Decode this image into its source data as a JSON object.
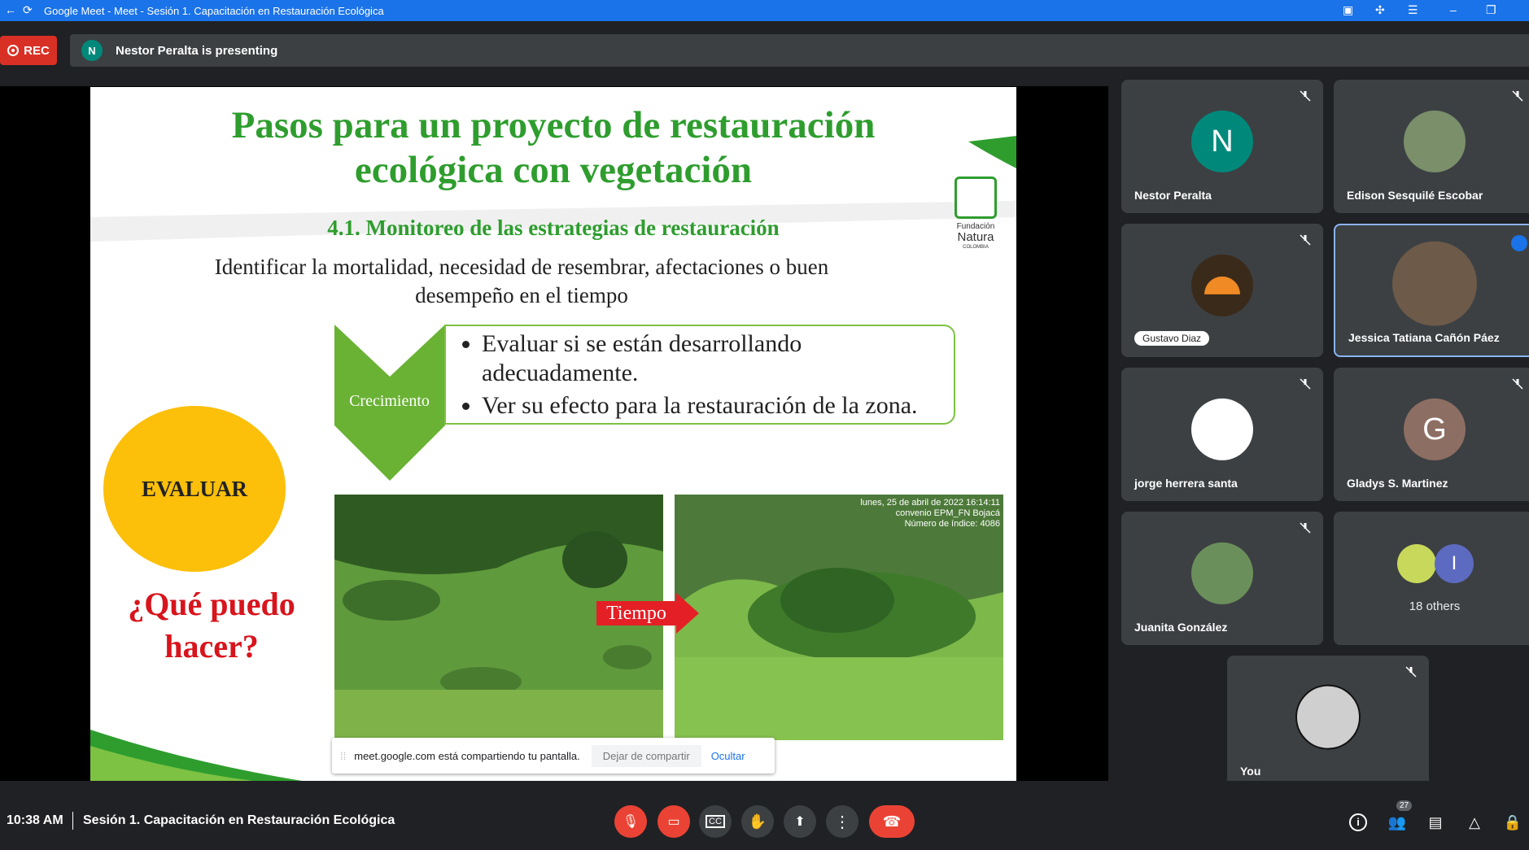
{
  "window": {
    "title": "Google Meet - Meet - Sesión 1. Capacitación en Restauración Ecológica"
  },
  "rec_label": "REC",
  "presenter": {
    "initial": "N",
    "text": "Nestor Peralta is presenting"
  },
  "slide": {
    "title_line1": "Pasos para un proyecto de restauración",
    "title_line2": "ecológica con vegetación",
    "subtitle": "4.1. Monitoreo de las estrategias de restauración",
    "description": "Identificar la mortalidad, necesidad de resembrar, afectaciones o buen desempeño en el tiempo",
    "chevron_label": "Crecimiento",
    "bullet1": "Evaluar si se están desarrollando adecuadamente.",
    "bullet2": "Ver su efecto para la restauración de la zona.",
    "evaluar": "EVALUAR",
    "question_line1": "¿Qué puedo",
    "question_line2": "hacer?",
    "tiempo": "Tiempo",
    "stamp_line1": "lunes, 25 de abril de 2022 16:14:11",
    "stamp_line2": "convenio EPM_FN Bojacá",
    "stamp_line3": "Número de índice: 4086",
    "logo_line1": "Fundación",
    "logo_line2": "Natura",
    "logo_line3": "COLOMBIA"
  },
  "share_bar": {
    "message": "meet.google.com está compartiendo tu pantalla.",
    "stop_label": "Dejar de compartir",
    "hide_label": "Ocultar"
  },
  "participants": [
    {
      "name": "Nestor Peralta",
      "initial": "N",
      "color": "#00897b"
    },
    {
      "name": "Edison Sesquilé Escobar"
    },
    {
      "name": "Gustavo Diaz"
    },
    {
      "name": "Jessica Tatiana Cañón Páez"
    },
    {
      "name": "jorge herrera santa"
    },
    {
      "name": "Gladys S. Martinez",
      "initial": "G",
      "color": "#8d6e63"
    },
    {
      "name": "Juanita González"
    },
    {
      "name": "18 others",
      "initial": "I"
    },
    {
      "name": "You"
    }
  ],
  "bottom": {
    "time": "10:38 AM",
    "meeting_name": "Sesión 1. Capacitación en Restauración Ecológica",
    "people_count": "27"
  }
}
